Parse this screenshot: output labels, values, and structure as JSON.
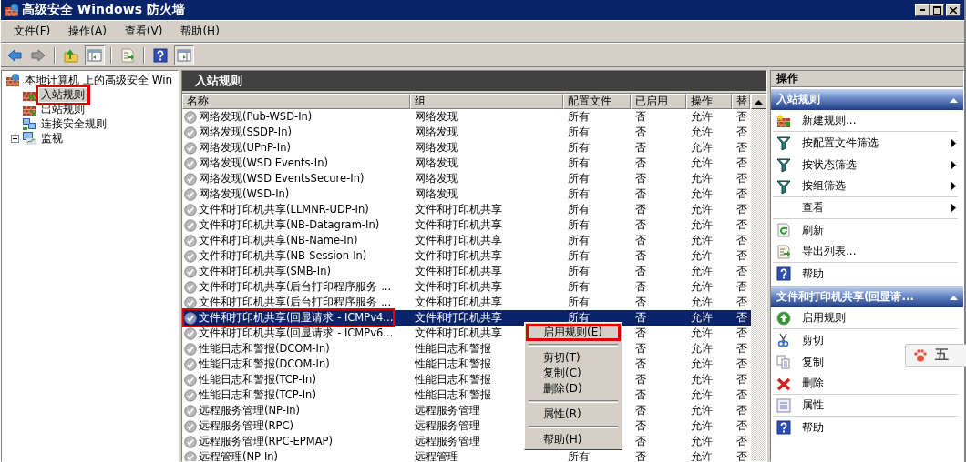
{
  "window": {
    "title": "高级安全 Windows 防火墙"
  },
  "menu": [
    "文件(F)",
    "操作(A)",
    "查看(V)",
    "帮助(H)"
  ],
  "toolbar": [
    {
      "pressed": false
    },
    {
      "pressed": false
    },
    {
      "pressed": false
    },
    {
      "pressed": true
    },
    {
      "pressed": false
    },
    {
      "pressed": false
    },
    {
      "pressed": true
    }
  ],
  "tree": [
    {
      "label": "本地计算机 上的高级安全 Win",
      "children": [
        {
          "label": "入站规则",
          "selected": true,
          "highlighted": true
        },
        {
          "label": "出站规则",
          "selected": false,
          "highlighted": false
        },
        {
          "label": "连接安全规则",
          "selected": false,
          "highlighted": false
        },
        {
          "label": "监视",
          "selected": false,
          "highlighted": false,
          "expanded": false
        }
      ]
    }
  ],
  "table": {
    "title": "入站规则",
    "columns": [
      "名称",
      "组",
      "配置文件",
      "已启用",
      "操作",
      "替"
    ],
    "rows": [
      {
        "cells": [
          "网络发现(Pub-WSD-In)",
          "网络发现",
          "所有",
          "否",
          "允许",
          "否"
        ],
        "selected": false,
        "highlighted": false
      },
      {
        "cells": [
          "网络发现(SSDP-In)",
          "网络发现",
          "所有",
          "否",
          "允许",
          "否"
        ],
        "selected": false,
        "highlighted": false
      },
      {
        "cells": [
          "网络发现(UPnP-In)",
          "网络发现",
          "所有",
          "否",
          "允许",
          "否"
        ],
        "selected": false,
        "highlighted": false
      },
      {
        "cells": [
          "网络发现(WSD Events-In)",
          "网络发现",
          "所有",
          "否",
          "允许",
          "否"
        ],
        "selected": false,
        "highlighted": false
      },
      {
        "cells": [
          "网络发现(WSD EventsSecure-In)",
          "网络发现",
          "所有",
          "否",
          "允许",
          "否"
        ],
        "selected": false,
        "highlighted": false
      },
      {
        "cells": [
          "网络发现(WSD-In)",
          "网络发现",
          "所有",
          "否",
          "允许",
          "否"
        ],
        "selected": false,
        "highlighted": false
      },
      {
        "cells": [
          "文件和打印机共享(LLMNR-UDP-In)",
          "文件和打印机共享",
          "所有",
          "否",
          "允许",
          "否"
        ],
        "selected": false,
        "highlighted": false
      },
      {
        "cells": [
          "文件和打印机共享(NB-Datagram-In)",
          "文件和打印机共享",
          "所有",
          "否",
          "允许",
          "否"
        ],
        "selected": false,
        "highlighted": false
      },
      {
        "cells": [
          "文件和打印机共享(NB-Name-In)",
          "文件和打印机共享",
          "所有",
          "否",
          "允许",
          "否"
        ],
        "selected": false,
        "highlighted": false
      },
      {
        "cells": [
          "文件和打印机共享(NB-Session-In)",
          "文件和打印机共享",
          "所有",
          "否",
          "允许",
          "否"
        ],
        "selected": false,
        "highlighted": false
      },
      {
        "cells": [
          "文件和打印机共享(SMB-In)",
          "文件和打印机共享",
          "所有",
          "否",
          "允许",
          "否"
        ],
        "selected": false,
        "highlighted": false
      },
      {
        "cells": [
          "文件和打印机共享(后台打印程序服务 ...",
          "文件和打印机共享",
          "所有",
          "否",
          "允许",
          "否"
        ],
        "selected": false,
        "highlighted": false
      },
      {
        "cells": [
          "文件和打印机共享(后台打印程序服务 ...",
          "文件和打印机共享",
          "所有",
          "否",
          "允许",
          "否"
        ],
        "selected": false,
        "highlighted": false
      },
      {
        "cells": [
          "文件和打印机共享(回显请求 - ICMPv4...",
          "文件和打印机共享",
          "所有",
          "否",
          "允许",
          "否"
        ],
        "selected": true,
        "highlighted": true
      },
      {
        "cells": [
          "文件和打印机共享(回显请求 - ICMPv6...",
          "文件和打印机共享",
          "",
          "否",
          "允许",
          "否"
        ],
        "selected": false,
        "highlighted": false
      },
      {
        "cells": [
          "性能日志和警报(DCOM-In)",
          "性能日志和警报",
          "",
          "否",
          "允许",
          "否"
        ],
        "selected": false,
        "highlighted": false
      },
      {
        "cells": [
          "性能日志和警报(DCOM-In)",
          "性能日志和警报",
          "",
          "否",
          "允许",
          "否"
        ],
        "selected": false,
        "highlighted": false
      },
      {
        "cells": [
          "性能日志和警报(TCP-In)",
          "性能日志和警报",
          "",
          "否",
          "允许",
          "否"
        ],
        "selected": false,
        "highlighted": false
      },
      {
        "cells": [
          "性能日志和警报(TCP-In)",
          "性能日志和警报",
          "",
          "否",
          "允许",
          "否"
        ],
        "selected": false,
        "highlighted": false
      },
      {
        "cells": [
          "远程服务管理(NP-In)",
          "远程服务管理",
          "",
          "否",
          "允许",
          "否"
        ],
        "selected": false,
        "highlighted": false
      },
      {
        "cells": [
          "远程服务管理(RPC)",
          "远程服务管理",
          "",
          "否",
          "允许",
          "否"
        ],
        "selected": false,
        "highlighted": false
      },
      {
        "cells": [
          "远程服务管理(RPC-EPMAP)",
          "远程服务管理",
          "",
          "否",
          "允许",
          "否"
        ],
        "selected": false,
        "highlighted": false
      },
      {
        "cells": [
          "远程管理(NP-In)",
          "远程管理",
          "所有",
          "否",
          "允许",
          "否"
        ],
        "selected": false,
        "highlighted": false
      }
    ]
  },
  "context_menu": [
    {
      "kind": "item",
      "label": "启用规则(E)",
      "highlighted": true
    },
    {
      "kind": "separator"
    },
    {
      "kind": "item",
      "label": "剪切(T)",
      "highlighted": false
    },
    {
      "kind": "item",
      "label": "复制(C)",
      "highlighted": false
    },
    {
      "kind": "item",
      "label": "删除(D)",
      "highlighted": false
    },
    {
      "kind": "separator"
    },
    {
      "kind": "item",
      "label": "属性(R)",
      "highlighted": false
    },
    {
      "kind": "separator"
    },
    {
      "kind": "item",
      "label": "帮助(H)",
      "highlighted": false
    }
  ],
  "actions": {
    "title": "操作",
    "sections": [
      {
        "title": "入站规则",
        "expanded": true,
        "items": [
          {
            "label": "新建规则...",
            "submenu": false,
            "separator_after": true
          },
          {
            "label": "按配置文件筛选",
            "submenu": true,
            "separator_after": false
          },
          {
            "label": "按状态筛选",
            "submenu": true,
            "separator_after": false
          },
          {
            "label": "按组筛选",
            "submenu": true,
            "separator_after": true
          },
          {
            "label": "查看",
            "submenu": true,
            "separator_after": true
          },
          {
            "label": "刷新",
            "submenu": false,
            "separator_after": false
          },
          {
            "label": "导出列表...",
            "submenu": false,
            "separator_after": true
          },
          {
            "label": "帮助",
            "submenu": false,
            "separator_after": false
          }
        ]
      },
      {
        "title": "文件和打印机共享(回显请...",
        "expanded": true,
        "items": [
          {
            "label": "启用规则",
            "submenu": false,
            "separator_after": true
          },
          {
            "label": "剪切",
            "submenu": false,
            "separator_after": false
          },
          {
            "label": "复制",
            "submenu": false,
            "separator_after": false
          },
          {
            "label": "删除",
            "submenu": false,
            "separator_after": true
          },
          {
            "label": "属性",
            "submenu": false,
            "separator_after": true
          },
          {
            "label": "帮助",
            "submenu": false,
            "separator_after": false
          }
        ]
      }
    ]
  },
  "ime_toolbar": {
    "label": "五"
  }
}
